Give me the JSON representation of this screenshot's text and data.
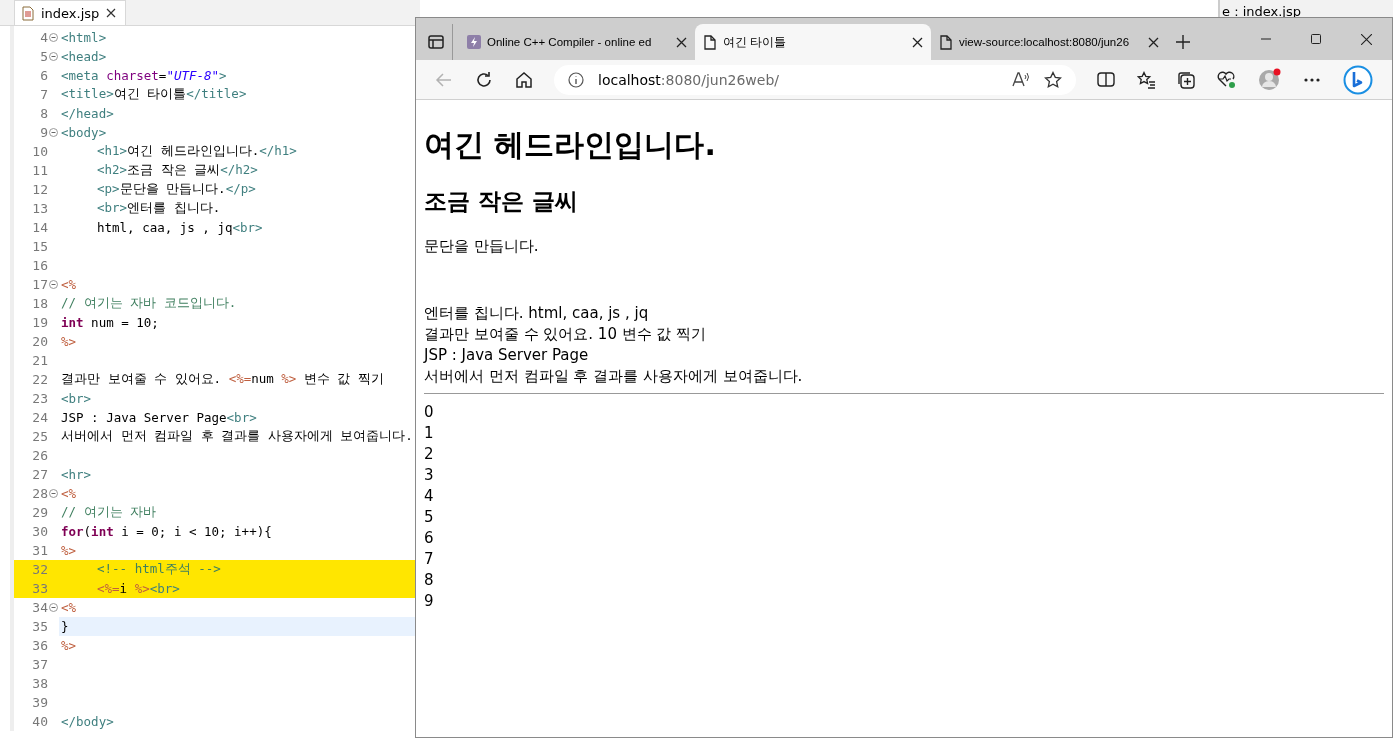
{
  "editor": {
    "tab": {
      "label": "index.jsp",
      "selected": true
    },
    "lines": [
      {
        "number": "4",
        "foldable": true,
        "tokens": [
          {
            "kind": "tag",
            "text": "<html>"
          }
        ]
      },
      {
        "number": "5",
        "foldable": true,
        "tokens": [
          {
            "kind": "tag",
            "text": "<head>"
          }
        ]
      },
      {
        "number": "6",
        "tokens": [
          {
            "kind": "tag",
            "text": "<meta "
          },
          {
            "kind": "attr",
            "text": "charset"
          },
          {
            "kind": "text",
            "text": "="
          },
          {
            "kind": "string",
            "text": "\"UTF-8\""
          },
          {
            "kind": "tag",
            "text": ">"
          }
        ]
      },
      {
        "number": "7",
        "tokens": [
          {
            "kind": "tag",
            "text": "<title>"
          },
          {
            "kind": "text",
            "text": "여긴 타이틀"
          },
          {
            "kind": "tag",
            "text": "</title>"
          }
        ]
      },
      {
        "number": "8",
        "tokens": [
          {
            "kind": "tag",
            "text": "</head>"
          }
        ]
      },
      {
        "number": "9",
        "foldable": true,
        "tokens": [
          {
            "kind": "tag",
            "text": "<body>"
          }
        ]
      },
      {
        "number": "10",
        "indented": true,
        "tokens": [
          {
            "kind": "tag",
            "text": "<h1>"
          },
          {
            "kind": "text",
            "text": "여긴 헤드라인입니다."
          },
          {
            "kind": "tag",
            "text": "</h1>"
          }
        ]
      },
      {
        "number": "11",
        "indented": true,
        "tokens": [
          {
            "kind": "tag",
            "text": "<h2>"
          },
          {
            "kind": "text",
            "text": "조금 작은 글씨"
          },
          {
            "kind": "tag",
            "text": "</h2>"
          }
        ]
      },
      {
        "number": "12",
        "indented": true,
        "tokens": [
          {
            "kind": "tag",
            "text": "<p>"
          },
          {
            "kind": "text",
            "text": "문단을 만듭니다."
          },
          {
            "kind": "tag",
            "text": "</p>"
          }
        ]
      },
      {
        "number": "13",
        "indented": true,
        "tokens": [
          {
            "kind": "tag",
            "text": "<br>"
          },
          {
            "kind": "text",
            "text": "엔터를 칩니다."
          }
        ]
      },
      {
        "number": "14",
        "indented": true,
        "tokens": [
          {
            "kind": "text",
            "text": "html, caa, js , jq"
          },
          {
            "kind": "tag",
            "text": "<br>"
          }
        ]
      },
      {
        "number": "15"
      },
      {
        "number": "16"
      },
      {
        "number": "17",
        "foldable": true,
        "tokens": [
          {
            "kind": "jsp",
            "text": "<%"
          }
        ]
      },
      {
        "number": "18",
        "tokens": [
          {
            "kind": "comment",
            "text": "// 여기는 자바 코드입니다."
          }
        ]
      },
      {
        "number": "19",
        "tokens": [
          {
            "kind": "keyword",
            "text": "int"
          },
          {
            "kind": "text",
            "text": " num = 10;"
          }
        ]
      },
      {
        "number": "20",
        "tokens": [
          {
            "kind": "jsp",
            "text": "%>"
          }
        ]
      },
      {
        "number": "21"
      },
      {
        "number": "22",
        "tokens": [
          {
            "kind": "text",
            "text": "결과만 보여줄 수 있어요. "
          },
          {
            "kind": "jsp",
            "text": "<%="
          },
          {
            "kind": "text",
            "text": "num "
          },
          {
            "kind": "jsp",
            "text": "%>"
          },
          {
            "kind": "text",
            "text": " 변수 값 찍기"
          }
        ]
      },
      {
        "number": "23",
        "tokens": [
          {
            "kind": "tag",
            "text": "<br>"
          }
        ]
      },
      {
        "number": "24",
        "tokens": [
          {
            "kind": "text",
            "text": "JSP : Java Server Page"
          },
          {
            "kind": "tag",
            "text": "<br>"
          }
        ]
      },
      {
        "number": "25",
        "tokens": [
          {
            "kind": "text",
            "text": "서버에서 먼저 컴파일 후 결과를 사용자에게 보여줍니다."
          }
        ]
      },
      {
        "number": "26"
      },
      {
        "number": "27",
        "tokens": [
          {
            "kind": "tag",
            "text": "<hr>"
          }
        ]
      },
      {
        "number": "28",
        "foldable": true,
        "tokens": [
          {
            "kind": "jsp",
            "text": "<%"
          }
        ]
      },
      {
        "number": "29",
        "tokens": [
          {
            "kind": "comment",
            "text": "// 여기는 자바"
          }
        ]
      },
      {
        "number": "30",
        "tokens": [
          {
            "kind": "keyword",
            "text": "for"
          },
          {
            "kind": "text",
            "text": "("
          },
          {
            "kind": "keyword",
            "text": "int"
          },
          {
            "kind": "text",
            "text": " i = 0; i < 10; i++){"
          }
        ]
      },
      {
        "number": "31",
        "tokens": [
          {
            "kind": "jsp",
            "text": "%>"
          }
        ]
      },
      {
        "number": "32",
        "indented": true,
        "highlighted": true,
        "tokens": [
          {
            "kind": "comment",
            "text": "<!-- html주석 -->"
          }
        ]
      },
      {
        "number": "33",
        "indented": true,
        "highlighted": true,
        "tokens": [
          {
            "kind": "jsp",
            "text": "<%="
          },
          {
            "kind": "text",
            "text": "i "
          },
          {
            "kind": "jsp",
            "text": "%>"
          },
          {
            "kind": "tag",
            "text": "<br>"
          }
        ]
      },
      {
        "number": "34",
        "foldable": true,
        "tokens": [
          {
            "kind": "jsp",
            "text": "<%"
          }
        ]
      },
      {
        "number": "35",
        "current": true,
        "tokens": [
          {
            "kind": "text",
            "text": "}"
          }
        ]
      },
      {
        "number": "36",
        "tokens": [
          {
            "kind": "jsp",
            "text": "%>"
          }
        ]
      },
      {
        "number": "37"
      },
      {
        "number": "38"
      },
      {
        "number": "39"
      },
      {
        "number": "40",
        "tokens": [
          {
            "kind": "tag",
            "text": "</body>"
          }
        ]
      }
    ]
  },
  "background_panel": {
    "title": "e : index.jsp"
  },
  "browser": {
    "tabs": [
      {
        "label": "Online C++ Compiler - online ed",
        "selected": false,
        "kind": "bolt"
      },
      {
        "label": "여긴 타이틀",
        "selected": true,
        "kind": "page"
      },
      {
        "label": "view-source:localhost:8080/jun26",
        "selected": false,
        "kind": "page"
      }
    ],
    "address": {
      "host": "localhost",
      "path": ":8080/jun26web/"
    },
    "back_disabled": true,
    "page": {
      "heading": "여긴 헤드라인입니다.",
      "subheading": "조금 작은 글씨",
      "paragraph": "문단을 만듭니다.",
      "lines": [
        "엔터를 칩니다. html, caa, js , jq",
        "결과만 보여줄 수 있어요. 10 변수 값 찍기",
        "JSP : Java Server Page",
        "서버에서 먼저 컴파일 후 결과를 사용자에게 보여줍니다."
      ],
      "numbers": [
        "0",
        "1",
        "2",
        "3",
        "4",
        "5",
        "6",
        "7",
        "8",
        "9"
      ]
    }
  }
}
